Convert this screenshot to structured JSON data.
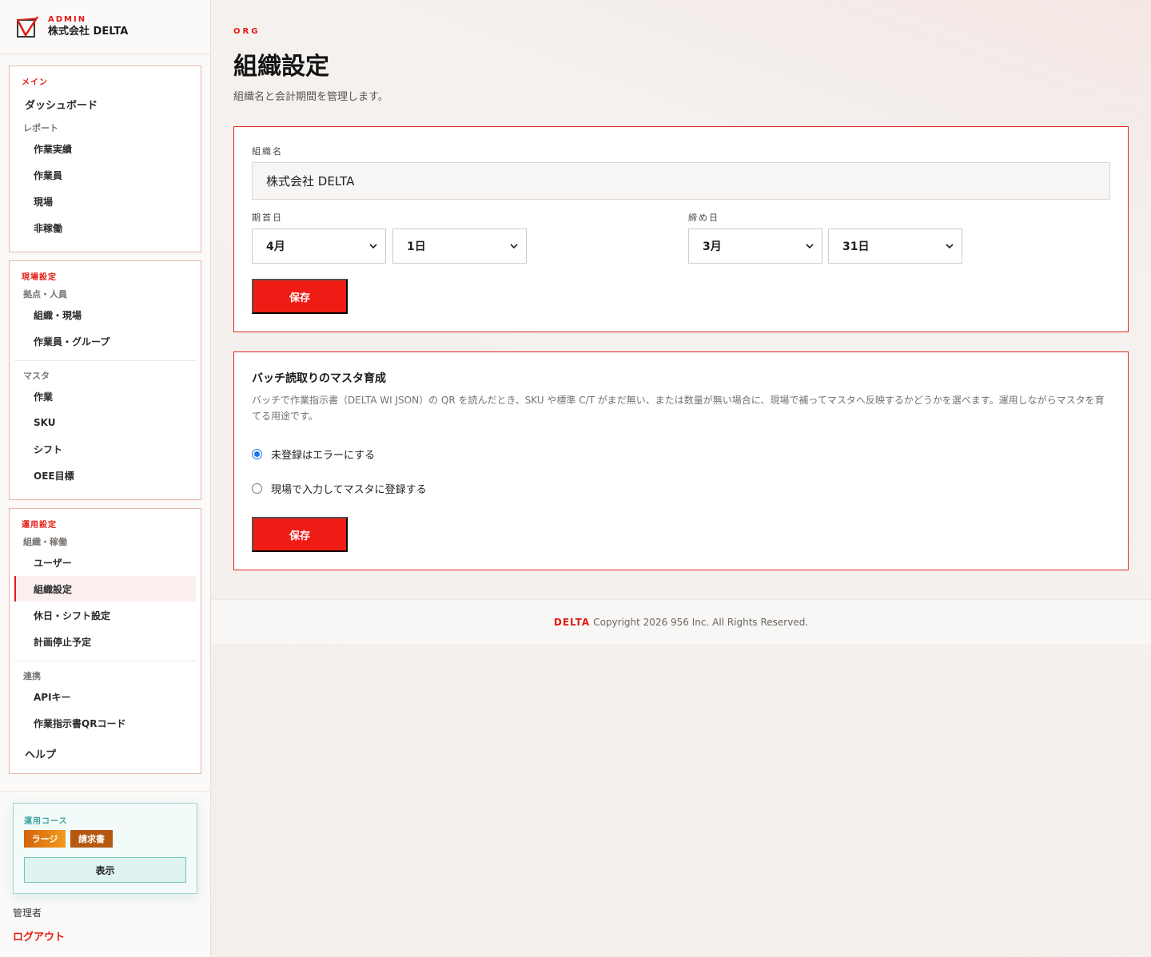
{
  "brand": {
    "kicker": "ADMIN",
    "name": "株式会社 DELTA"
  },
  "sidebar": {
    "main": {
      "title": "メイン",
      "dashboard": "ダッシュボード",
      "reports_group": "レポート",
      "items": [
        "作業実績",
        "作業員",
        "現場",
        "非稼働"
      ]
    },
    "site_settings": {
      "title": "現場設定",
      "group1": "拠点・人員",
      "group1_items": [
        "組織・現場",
        "作業員・グループ"
      ],
      "group2": "マスタ",
      "group2_items": [
        "作業",
        "SKU",
        "シフト",
        "OEE目標"
      ]
    },
    "ops_settings": {
      "title": "運用設定",
      "group1": "組織・稼働",
      "group1_items": [
        "ユーザー",
        "組織設定",
        "休日・シフト設定",
        "計画停止予定"
      ],
      "group2": "連携",
      "group2_items": [
        "APIキー",
        "作業指示書QRコード"
      ],
      "help": "ヘルプ"
    },
    "active_item": "組織設定",
    "plan": {
      "title": "運用コース",
      "badges": [
        "ラージ",
        "請求書"
      ],
      "button": "表示"
    },
    "user_role": "管理者",
    "logout": "ログアウト"
  },
  "header": {
    "kicker": "ORG",
    "title": "組織設定",
    "subtitle": "組織名と会計期間を管理します。"
  },
  "org_form": {
    "name_label": "組織名",
    "name_value": "株式会社 DELTA",
    "start_label": "期首日",
    "start_month": "4月",
    "start_day": "1日",
    "end_label": "締め日",
    "end_month": "3月",
    "end_day": "31日",
    "save": "保存"
  },
  "batch_form": {
    "title": "バッチ読取りのマスタ育成",
    "description": "バッチで作業指示書（DELTA WI JSON）の QR を読んだとき、SKU や標準 C/T がまだ無い、または数量が無い場合に、現場で補ってマスタへ反映するかどうかを選べます。運用しながらマスタを育てる用途です。",
    "options": [
      "未登録はエラーにする",
      "現場で入力してマスタに登録する"
    ],
    "selected_index": 0,
    "save": "保存"
  },
  "footer": {
    "brand": "DELTA",
    "copyright": "Copyright 2026 956 Inc. All Rights Reserved."
  },
  "colors": {
    "accent": "#e31b13",
    "teal": "#3ea7a0"
  }
}
